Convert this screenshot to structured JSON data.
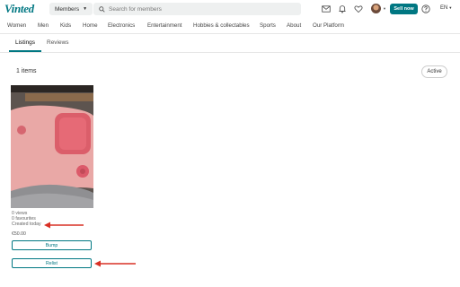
{
  "header": {
    "logo": "Vinted",
    "members_dropdown": "Members",
    "search_placeholder": "Search for members",
    "sell_now": "Sell now",
    "language": "EN"
  },
  "categories": [
    "Women",
    "Men",
    "Kids",
    "Home",
    "Electronics",
    "Entertainment",
    "Hobbies & collectables",
    "Sports",
    "About",
    "Our Platform"
  ],
  "tabs": [
    {
      "label": "Listings",
      "active": true
    },
    {
      "label": "Reviews",
      "active": false
    }
  ],
  "listings": {
    "count_label": "1 items",
    "filter_button": "Active"
  },
  "item": {
    "views": "0 views",
    "favourites": "0 favourites",
    "created": "Created today",
    "price": "€50.00",
    "bump_button": "Bump",
    "relist_button": "Relist"
  },
  "colors": {
    "brand": "#007782",
    "annotation_arrow": "#d93025"
  },
  "icons": [
    "search-icon",
    "mail-icon",
    "bell-icon",
    "heart-icon",
    "help-icon",
    "chevron-down-icon"
  ]
}
